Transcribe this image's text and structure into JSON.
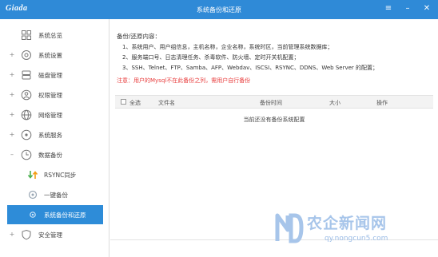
{
  "app": {
    "logo": "Giada",
    "title": "系统备份和还原",
    "window_buttons": {
      "menu": "≡",
      "minimize": "–",
      "close": "✕"
    }
  },
  "sidebar": {
    "items": [
      {
        "label": "系统总览",
        "icon": "grid-icon",
        "expander": ""
      },
      {
        "label": "系统设置",
        "icon": "gear-icon",
        "expander": "+"
      },
      {
        "label": "磁盘管理",
        "icon": "disk-icon",
        "expander": "+"
      },
      {
        "label": "权限管理",
        "icon": "user-icon",
        "expander": "+"
      },
      {
        "label": "网络管理",
        "icon": "globe-icon",
        "expander": "+"
      },
      {
        "label": "系统服务",
        "icon": "service-icon",
        "expander": "+"
      },
      {
        "label": "数据备份",
        "icon": "clock-icon",
        "expander": "–"
      },
      {
        "label": "RSYNC同步",
        "icon": "sync-arrows-icon",
        "expander": ""
      },
      {
        "label": "一键备份",
        "icon": "backup-icon",
        "expander": ""
      },
      {
        "label": "系统备份和还原",
        "icon": "dot-icon",
        "expander": ""
      },
      {
        "label": "安全管理",
        "icon": "shield-icon",
        "expander": "+"
      }
    ],
    "active_index": 9,
    "accent": "#2e8cd8"
  },
  "content": {
    "section_title": "备份/还原内容：",
    "lines": [
      "1、系统用户、用户组信息，主机名称，企业名称，系统时区，当前管理系统数据库；",
      "2、服务端口号、日志清理任务、杀毒软件、防火墙、定时开关机配置；",
      "3、SSH、Telnet、FTP、Samba、AFP、Webdav、ISCSI、RSYNC、DDNS、Web Server 的配置；"
    ],
    "warning": "注意：用户的Mysql不在此备份之列，需用户自行备份",
    "warning_color": "#e83b3b"
  },
  "table": {
    "select_all": "全选",
    "columns": [
      "文件名",
      "备份时间",
      "大小",
      "操作"
    ],
    "empty_text": "当前还没有备份系统配置"
  },
  "watermark": {
    "title": "农企新闻网",
    "url": "qy.nongcun5.com"
  },
  "colors": {
    "titlebar": "#2f8ad7",
    "active_item": "#2e8cd8"
  }
}
